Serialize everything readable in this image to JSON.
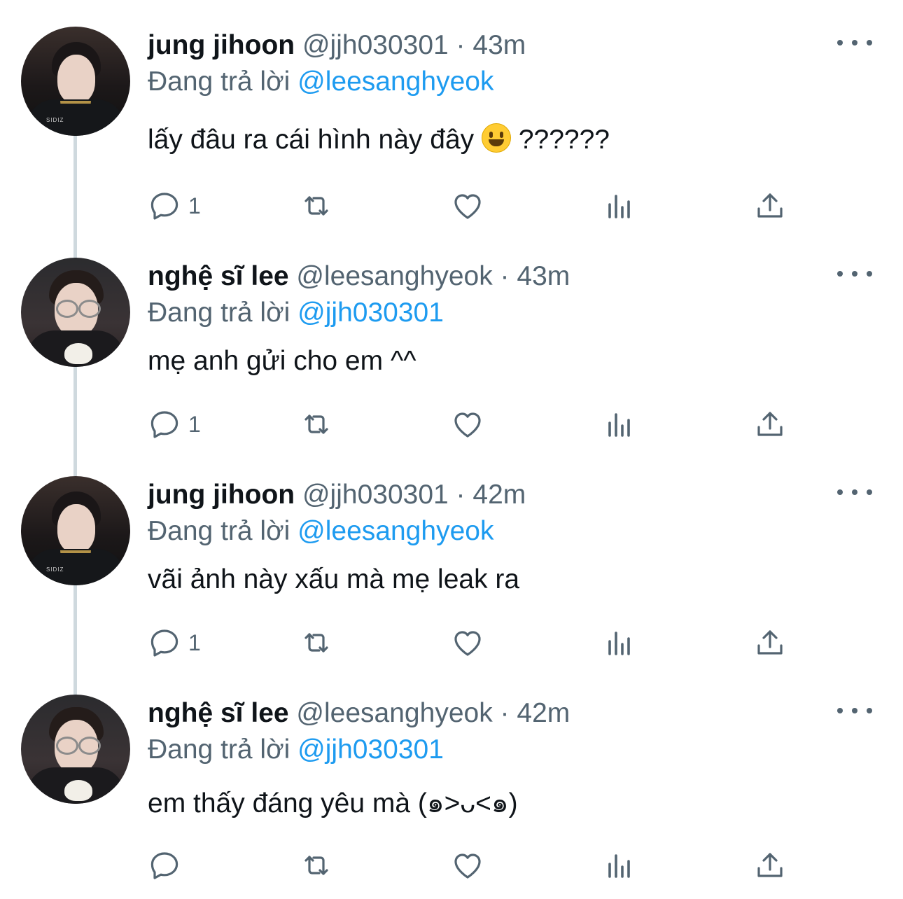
{
  "tweets": [
    {
      "name": "jung jihoon",
      "handle": "@jjh030301",
      "separator": "·",
      "time": "43m",
      "replying_prefix": "Đang trả lời",
      "replying_to": "@leesanghyeok",
      "text": "lấy đâu ra cái hình này đây",
      "text_suffix": "??????",
      "emoji": "smiley-emoji",
      "avatar_logo": "SIDIZ",
      "reply_count": "1"
    },
    {
      "name": "nghệ sĩ lee",
      "handle": "@leesanghyeok",
      "separator": "·",
      "time": "43m",
      "replying_prefix": "Đang trả lời",
      "replying_to": "@jjh030301",
      "text": "mẹ anh gửi cho em ^^",
      "reply_count": "1"
    },
    {
      "name": "jung jihoon",
      "handle": "@jjh030301",
      "separator": "·",
      "time": "42m",
      "replying_prefix": "Đang trả lời",
      "replying_to": "@leesanghyeok",
      "text": "vãi ảnh này xấu mà mẹ leak ra",
      "avatar_logo": "SIDIZ",
      "reply_count": "1"
    },
    {
      "name": "nghệ sĩ lee",
      "handle": "@leesanghyeok",
      "separator": "·",
      "time": "42m",
      "replying_prefix": "Đang trả lời",
      "replying_to": "@jjh030301",
      "text": "em thấy đáng yêu mà (๑>ᴗ<๑)",
      "reply_count": ""
    }
  ],
  "icons": {
    "reply": "reply-icon",
    "retweet": "retweet-icon",
    "like": "heart-icon",
    "stats": "stats-icon",
    "share": "share-icon",
    "more": "more-icon"
  },
  "colors": {
    "mention": "#1d9bf0",
    "secondary_text": "#536471",
    "thread_line": "#cfd9de"
  }
}
